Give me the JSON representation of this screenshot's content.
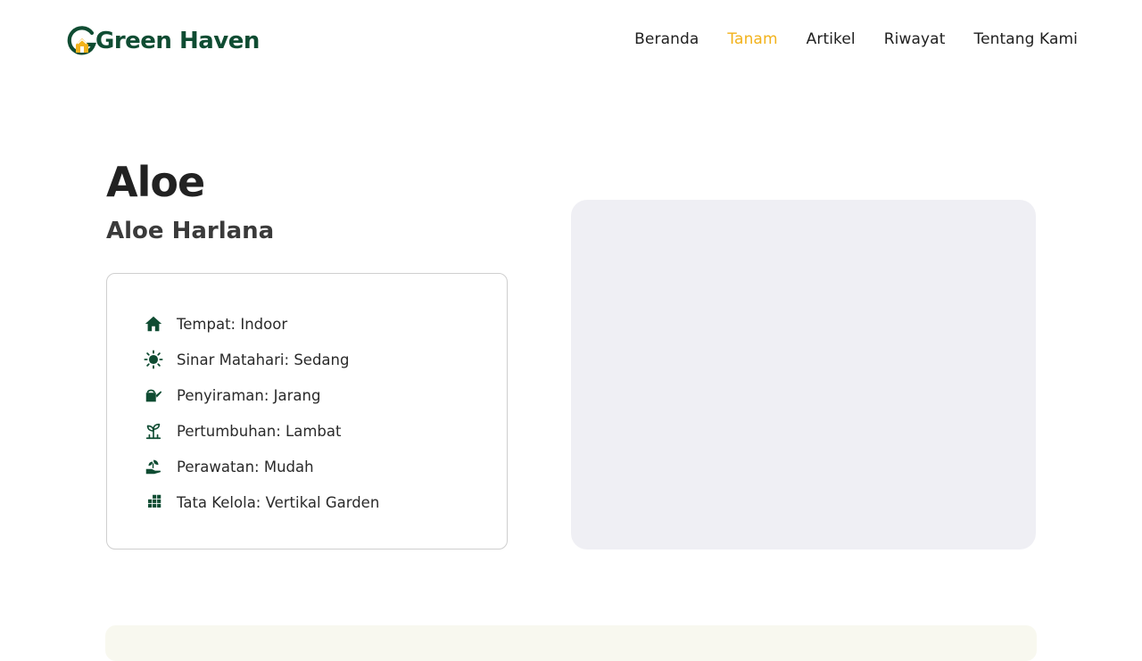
{
  "brand": {
    "name": "Green Haven",
    "color": "#0f4c32",
    "accent": "#f2b21b"
  },
  "nav": {
    "items": [
      {
        "label": "Beranda",
        "active": false
      },
      {
        "label": "Tanam",
        "active": true
      },
      {
        "label": "Artikel",
        "active": false
      },
      {
        "label": "Riwayat",
        "active": false
      },
      {
        "label": "Tentang Kami",
        "active": false
      }
    ]
  },
  "plant": {
    "name": "Aloe",
    "latin_name": "Aloe Harlana",
    "details": [
      {
        "icon": "house-icon",
        "text": "Tempat: Indoor"
      },
      {
        "icon": "sun-icon",
        "text": "Sinar Matahari: Sedang"
      },
      {
        "icon": "watering-can-icon",
        "text": "Penyiraman: Jarang"
      },
      {
        "icon": "sprout-icon",
        "text": "Pertumbuhan: Lambat"
      },
      {
        "icon": "hand-plant-icon",
        "text": "Perawatan: Mudah"
      },
      {
        "icon": "grid-icon",
        "text": "Tata Kelola: Vertikal Garden"
      }
    ]
  }
}
